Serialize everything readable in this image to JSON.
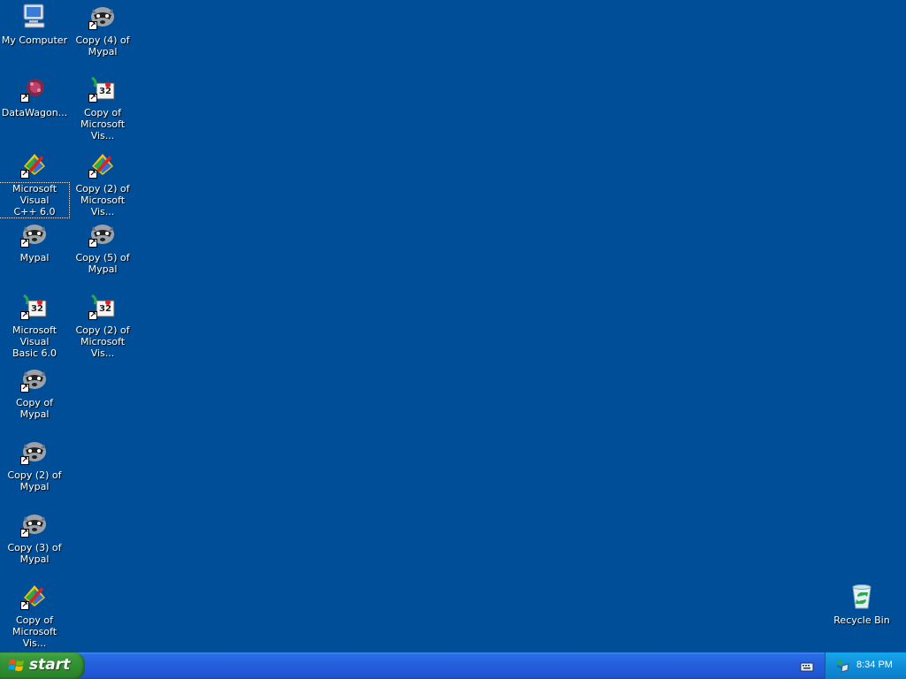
{
  "desktop": {
    "icons": [
      {
        "label": "My Computer",
        "icon": "my-computer-icon"
      },
      {
        "label": "DataWagon...",
        "icon": "datawagon-icon"
      },
      {
        "label": "Microsoft Visual\nC++ 6.0",
        "icon": "visual-cpp-icon"
      },
      {
        "label": "Mypal",
        "icon": "mypal-icon"
      },
      {
        "label": "Microsoft Visual\nBasic 6.0",
        "icon": "visual-basic-icon"
      },
      {
        "label": "Copy of Mypal",
        "icon": "mypal-icon"
      },
      {
        "label": "Copy (2) of\nMypal",
        "icon": "mypal-icon"
      },
      {
        "label": "Copy (3) of\nMypal",
        "icon": "mypal-icon"
      },
      {
        "label": "Copy of\nMicrosoft Vis...",
        "icon": "visual-cpp-icon"
      },
      {
        "label": "Copy (4) of\nMypal",
        "icon": "mypal-icon"
      },
      {
        "label": "Copy of\nMicrosoft Vis...",
        "icon": "visual-basic-icon"
      },
      {
        "label": "Copy (2) of\nMicrosoft Vis...",
        "icon": "visual-cpp-icon"
      },
      {
        "label": "Copy (5) of\nMypal",
        "icon": "mypal-icon"
      },
      {
        "label": "Copy (2) of\nMicrosoft Vis...",
        "icon": "visual-basic-icon"
      },
      {
        "label": "Recycle Bin",
        "icon": "recycle-bin-icon"
      }
    ]
  },
  "taskbar": {
    "start_label": "start",
    "clock": "8:34 PM"
  },
  "colors": {
    "desktop_background": "#004e98",
    "taskbar": "#245edb",
    "start_button": "#2f8d2f",
    "tray": "#0f8ed8"
  }
}
